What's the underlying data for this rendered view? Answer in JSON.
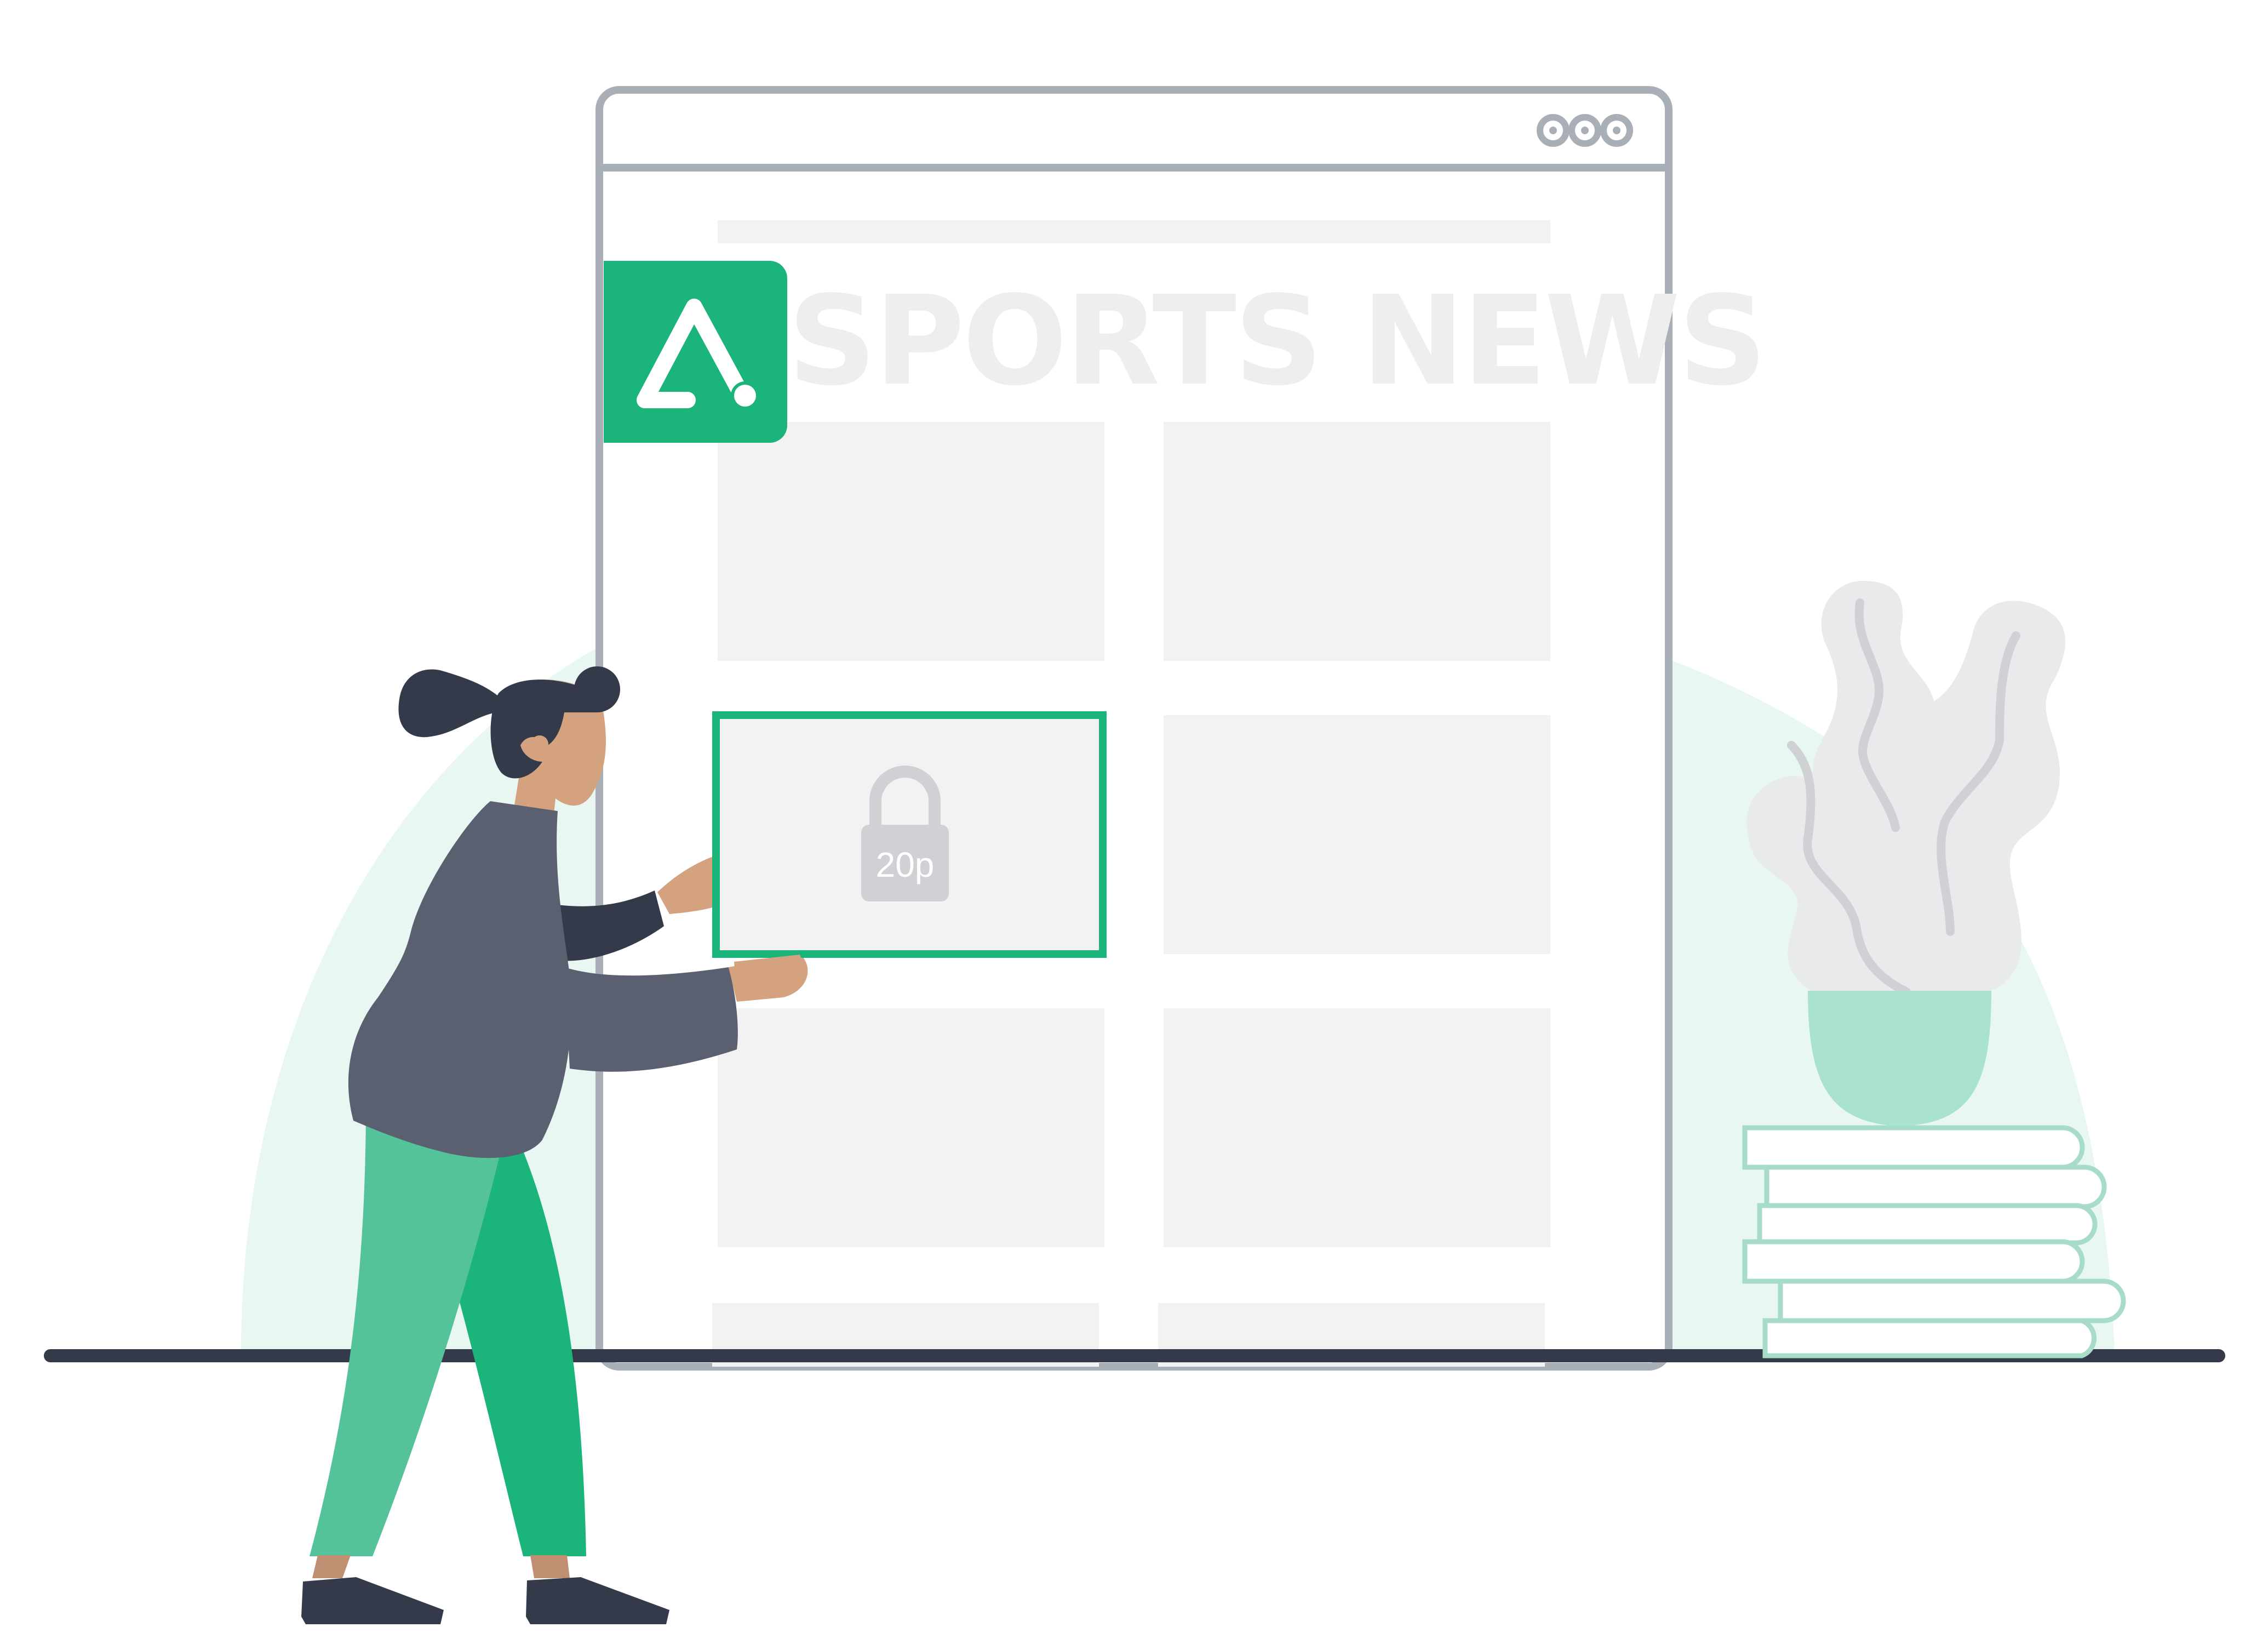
{
  "site": {
    "title": "SPORTS NEWS"
  },
  "browser": {
    "window_controls": [
      "dot-icon",
      "dot-icon",
      "dot-icon"
    ]
  },
  "paywall": {
    "price": "20p",
    "icon": "padlock-icon"
  },
  "brand": {
    "icon": "warning-triangle-logo-icon",
    "color": "#1bb47b"
  },
  "colors": {
    "frame": "#a9afb6",
    "placeholder": "#f2f2f2",
    "accent": "#1bb47b",
    "dark": "#353a4a",
    "shirt": "#5b6070",
    "skin": "#d4a27f",
    "plant": "#e9eaec",
    "pot": "#aae3cd",
    "books_outline": "#a7dcc8"
  }
}
